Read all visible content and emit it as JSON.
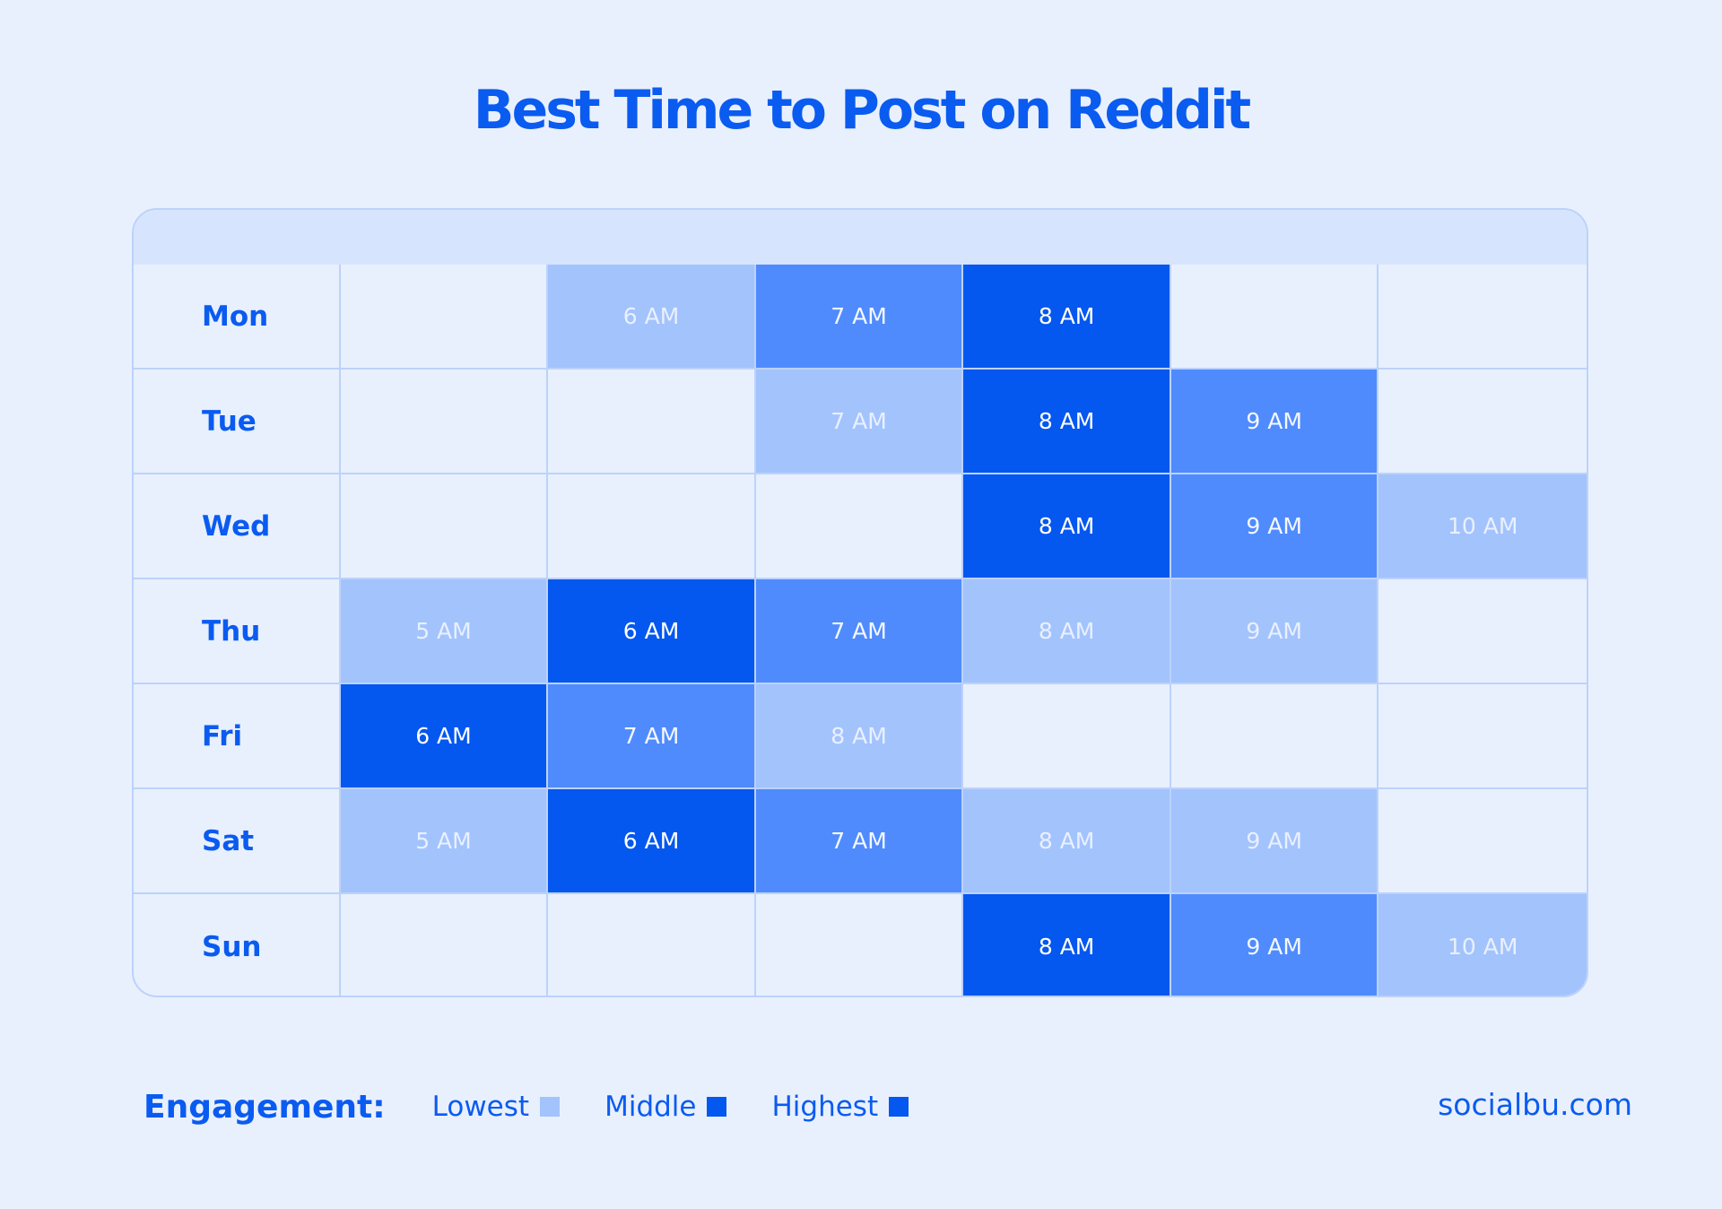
{
  "title": "Best Time to Post on Reddit",
  "colors": {
    "background": "#e9f0fd",
    "accent": "#0a5bf0",
    "lowest": "#a3c3fd",
    "middle": "#4f8bfd",
    "highest": "#0457ef",
    "empty": "#e8f0fe",
    "gridline": "#bcd2fb"
  },
  "legend": {
    "title": "Engagement:",
    "items": [
      {
        "label": "Lowest",
        "level": "low",
        "swatch_color": "#a3c3fd"
      },
      {
        "label": "Middle",
        "level": "high",
        "swatch_color": "#0457ef"
      },
      {
        "label": "Highest",
        "level": "high",
        "swatch_color": "#0457ef"
      }
    ]
  },
  "footer": {
    "site": "socialbu.com"
  },
  "chart_data": {
    "type": "heatmap",
    "title": "Best Time to Post on Reddit",
    "xlabel": "",
    "ylabel": "",
    "legend_title": "Engagement:",
    "legend_position": "bottom-left",
    "levels": [
      "none",
      "low",
      "mid",
      "high"
    ],
    "level_labels": {
      "low": "Lowest",
      "mid": "Middle",
      "high": "Highest"
    },
    "rows": [
      {
        "day": "Mon",
        "cells": [
          {
            "label": "",
            "level": "none"
          },
          {
            "label": "6 AM",
            "level": "low"
          },
          {
            "label": "7 AM",
            "level": "mid"
          },
          {
            "label": "8 AM",
            "level": "high"
          },
          {
            "label": "",
            "level": "none"
          },
          {
            "label": "",
            "level": "none"
          }
        ]
      },
      {
        "day": "Tue",
        "cells": [
          {
            "label": "",
            "level": "none"
          },
          {
            "label": "",
            "level": "none"
          },
          {
            "label": "7 AM",
            "level": "low"
          },
          {
            "label": "8 AM",
            "level": "high"
          },
          {
            "label": "9 AM",
            "level": "mid"
          },
          {
            "label": "",
            "level": "none"
          }
        ]
      },
      {
        "day": "Wed",
        "cells": [
          {
            "label": "",
            "level": "none"
          },
          {
            "label": "",
            "level": "none"
          },
          {
            "label": "",
            "level": "none"
          },
          {
            "label": "8 AM",
            "level": "high"
          },
          {
            "label": "9 AM",
            "level": "mid"
          },
          {
            "label": "10 AM",
            "level": "low"
          }
        ]
      },
      {
        "day": "Thu",
        "cells": [
          {
            "label": "5 AM",
            "level": "low"
          },
          {
            "label": "6 AM",
            "level": "high"
          },
          {
            "label": "7 AM",
            "level": "mid"
          },
          {
            "label": "8 AM",
            "level": "low"
          },
          {
            "label": "9 AM",
            "level": "low"
          },
          {
            "label": "",
            "level": "none"
          }
        ]
      },
      {
        "day": "Fri",
        "cells": [
          {
            "label": "6 AM",
            "level": "high"
          },
          {
            "label": "7 AM",
            "level": "mid"
          },
          {
            "label": "8 AM",
            "level": "low"
          },
          {
            "label": "",
            "level": "none"
          },
          {
            "label": "",
            "level": "none"
          },
          {
            "label": "",
            "level": "none"
          }
        ]
      },
      {
        "day": "Sat",
        "cells": [
          {
            "label": "5 AM",
            "level": "low"
          },
          {
            "label": "6 AM",
            "level": "high"
          },
          {
            "label": "7 AM",
            "level": "mid"
          },
          {
            "label": "8 AM",
            "level": "low"
          },
          {
            "label": "9 AM",
            "level": "low"
          },
          {
            "label": "",
            "level": "none"
          }
        ]
      },
      {
        "day": "Sun",
        "cells": [
          {
            "label": "",
            "level": "none"
          },
          {
            "label": "",
            "level": "none"
          },
          {
            "label": "",
            "level": "none"
          },
          {
            "label": "8 AM",
            "level": "high"
          },
          {
            "label": "9 AM",
            "level": "mid"
          },
          {
            "label": "10 AM",
            "level": "low"
          }
        ]
      }
    ]
  }
}
